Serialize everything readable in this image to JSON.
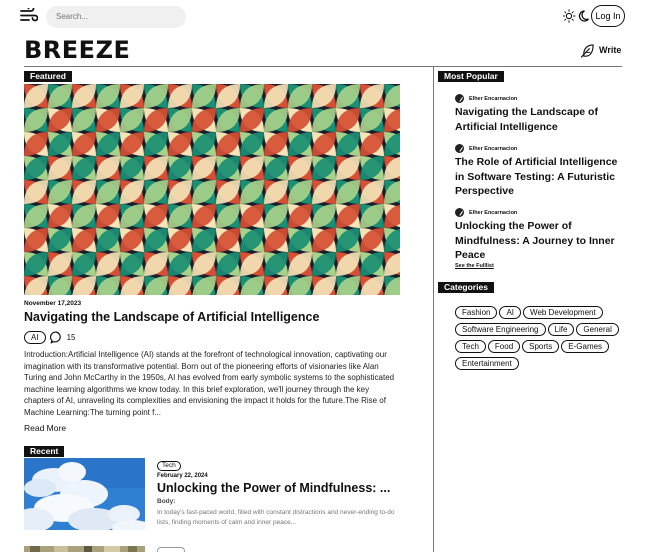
{
  "header": {
    "search_placeholder": "Search...",
    "login_label": "Log In",
    "brand": "BREEZE",
    "write_label": "Write"
  },
  "featured": {
    "tag_label": "Featured",
    "date": "November 17,2023",
    "title": "Navigating the Landscape of Artificial Intelligence",
    "category": "AI",
    "comment_count": "15",
    "excerpt": "Introduction:Artificial Intelligence (AI) stands at the forefront of technological innovation, captivating our imagination with its transformative potential. Born out of the pioneering efforts of visionaries like Alan Turing and John McCarthy in the 1950s, AI has evolved from early symbolic systems to the sophisticated machine learning algorithms we know today. In this brief exploration, we'll journey through the key chapters of AI, unraveling its complexities and envisioning the impact it holds for the future.The Rise of Machine Learning:The turning point f...",
    "read_more": "Read More",
    "pattern_colors": [
      "#1b1e2e",
      "#d74f34",
      "#f3e3b5",
      "#a8d18a",
      "#1a8f73"
    ]
  },
  "recent": {
    "tag_label": "Recent",
    "items": [
      {
        "category": "Tech",
        "date": "February 22, 2024",
        "title": "Unlocking the Power of Mindfulness: ...",
        "body_label": "Body:",
        "excerpt": "In today's fast-paced world, filled with constant distractions and never-ending to-do lists, finding moments of calm and inner peace..."
      }
    ]
  },
  "sidebar": {
    "popular_label": "Most Popular",
    "popular": [
      {
        "author": "Elher Encarnacion",
        "title": "Navigating the Landscape of Artificial Intelligence"
      },
      {
        "author": "Elher Encarnacion",
        "title": "The Role of Artificial Intelligence in Software Testing: A Futuristic Perspective"
      },
      {
        "author": "Elher Encarnacion",
        "title": "Unlocking the Power of Mindfulness: A Journey to Inner Peace"
      }
    ],
    "see_full_list": "See the Fulllist",
    "categories_label": "Categories",
    "categories": [
      "Fashion",
      "AI",
      "Web Development",
      "Software Engineering",
      "Life",
      "General",
      "Tech",
      "Food",
      "Sports",
      "E-Games",
      "Entertainment"
    ]
  }
}
